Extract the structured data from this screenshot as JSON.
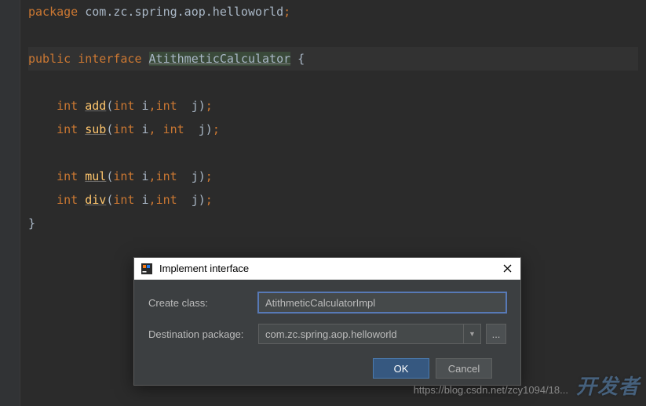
{
  "code": {
    "package_kw": "package",
    "package_name": " com.zc.spring.aop.helloworld",
    "semi": ";",
    "public_kw": "public ",
    "interface_kw": "interface ",
    "class_name": "AtithmeticCalculator",
    "open_brace": " {",
    "close_brace": "}",
    "int_kw": "int ",
    "add_name": "add",
    "sub_name": "sub",
    "mul_name": "mul",
    "div_name": "div",
    "sig_tight": "(int i,int j)",
    "sig_space": "(int i, int j)",
    "lp": "(",
    "rp": ")",
    "int_p": "int",
    "i_p": " i",
    "j_p": " j",
    "c": ",",
    "cs": ", "
  },
  "dialog": {
    "title": "Implement interface",
    "create_class_label": "Create class:",
    "create_class_value": "AtithmeticCalculatorImpl",
    "dest_pkg_label": "Destination package:",
    "dest_pkg_value": "com.zc.spring.aop.helloworld",
    "browse_label": "...",
    "ok_label": "OK",
    "cancel_label": "Cancel"
  },
  "watermark": {
    "url": "https://blog.csdn.net/zcy1094/18...",
    "brand": "开发者"
  }
}
